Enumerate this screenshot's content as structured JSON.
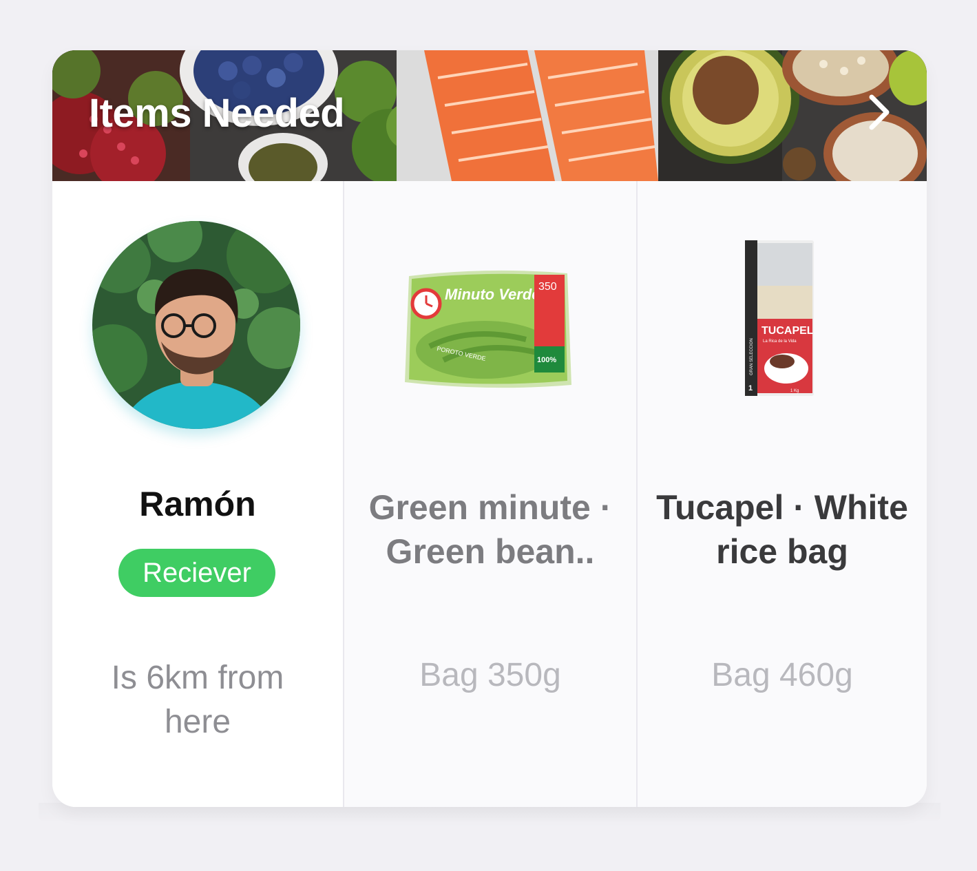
{
  "header": {
    "title": "Items Needed",
    "chevron_icon": "chevron-right-icon"
  },
  "receiver": {
    "name": "Ramón",
    "badge": "Reciever",
    "distance": "Is 6km from here",
    "badge_color": "#3fcd63"
  },
  "products": [
    {
      "title": "Green minute · Green bean..",
      "subtitle": "Bag 350g",
      "image_icon": "green-bean-bag-image"
    },
    {
      "title": "Tucapel · White rice bag",
      "subtitle": "Bag 460g",
      "image_icon": "rice-bag-image"
    }
  ],
  "product_labels": {
    "beans_brand": "Minuto Verde",
    "beans_weight": "350",
    "beans_variety": "POROTO VERDE",
    "beans_natural": "100%",
    "rice_brand": "TUCAPEL",
    "rice_slogan": "La Rica de la Vida",
    "rice_side": "GRAN SELECCION",
    "rice_grade": "1",
    "rice_weight": "1 Kg"
  },
  "colors": {
    "background": "#f1f0f4",
    "card": "#ffffff",
    "accent_green": "#3fcd63"
  }
}
